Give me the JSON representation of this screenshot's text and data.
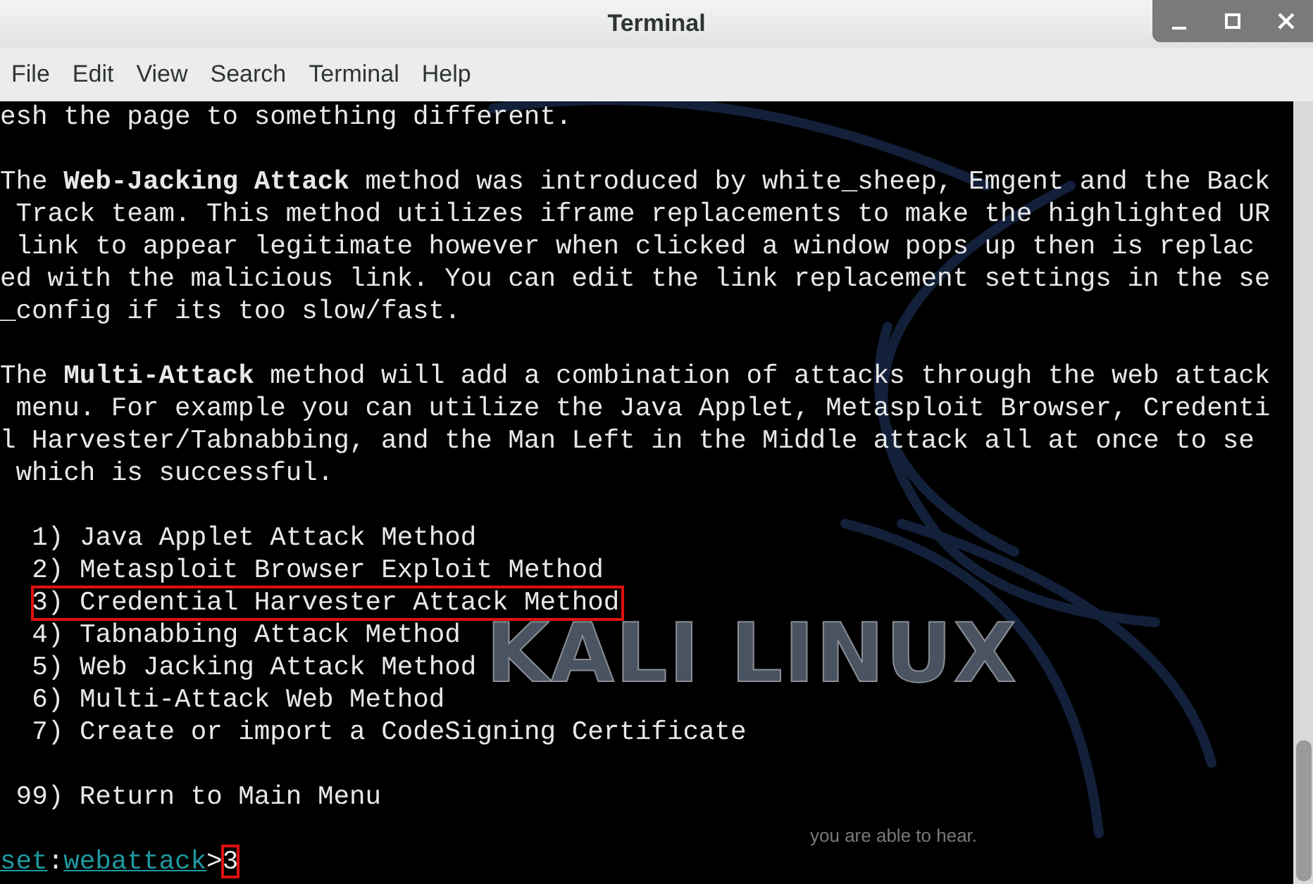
{
  "window": {
    "title": "Terminal"
  },
  "menu": [
    "File",
    "Edit",
    "View",
    "Search",
    "Terminal",
    "Help"
  ],
  "wallpaper": {
    "logo": "KALI LINUX",
    "tagline": "you are able to hear."
  },
  "terminal": {
    "lines": [
      {
        "kind": "text",
        "text": "esh the page to something different."
      },
      {
        "kind": "blank"
      },
      {
        "kind": "text",
        "text": "The **Web-Jacking Attack** method was introduced by white_sheep, Emgent and the Back"
      },
      {
        "kind": "text",
        "text": " Track team. This method utilizes iframe replacements to make the highlighted UR"
      },
      {
        "kind": "text",
        "text": " link to appear legitimate however when clicked a window pops up then is replac"
      },
      {
        "kind": "text",
        "text": "ed with the malicious link. You can edit the link replacement settings in the se"
      },
      {
        "kind": "text",
        "text": "_config if its too slow/fast."
      },
      {
        "kind": "blank"
      },
      {
        "kind": "text",
        "text": "The **Multi-Attack** method will add a combination of attacks through the web attack"
      },
      {
        "kind": "text",
        "text": " menu. For example you can utilize the Java Applet, Metasploit Browser, Credenti"
      },
      {
        "kind": "text",
        "text": "l Harvester/Tabnabbing, and the Man Left in the Middle attack all at once to se"
      },
      {
        "kind": "text",
        "text": " which is successful."
      },
      {
        "kind": "blank"
      },
      {
        "kind": "option",
        "number": "1)",
        "label": "Java Applet Attack Method",
        "highlighted": false
      },
      {
        "kind": "option",
        "number": "2)",
        "label": "Metasploit Browser Exploit Method",
        "highlighted": false
      },
      {
        "kind": "option",
        "number": "3)",
        "label": "Credential Harvester Attack Method",
        "highlighted": true
      },
      {
        "kind": "option",
        "number": "4)",
        "label": "Tabnabbing Attack Method",
        "highlighted": false
      },
      {
        "kind": "option",
        "number": "5)",
        "label": "Web Jacking Attack Method",
        "highlighted": false
      },
      {
        "kind": "option",
        "number": "6)",
        "label": "Multi-Attack Web Method",
        "highlighted": false
      },
      {
        "kind": "option",
        "number": "7)",
        "label": "Create or import a CodeSigning Certificate",
        "highlighted": false
      },
      {
        "kind": "blank"
      },
      {
        "kind": "option",
        "number": "99)",
        "label": "Return to Main Menu",
        "highlighted": false
      },
      {
        "kind": "blank"
      },
      {
        "kind": "prompt",
        "parts": [
          "set",
          ":",
          "webattack",
          ">"
        ],
        "input": "3",
        "highlighted": true
      }
    ]
  }
}
